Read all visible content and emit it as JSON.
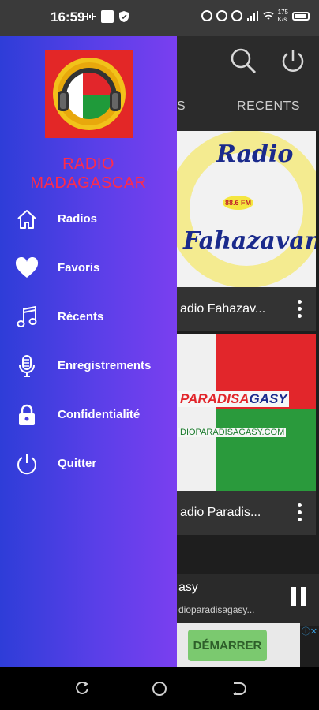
{
  "status_bar": {
    "time": "16:59",
    "net_speed_top": "175",
    "net_speed_bottom": "K/s"
  },
  "drawer": {
    "app_title_line1": "RADIO",
    "app_title_line2": "MADAGASCAR",
    "items": [
      {
        "label": "Radios",
        "icon": "home-icon"
      },
      {
        "label": "Favoris",
        "icon": "heart-icon"
      },
      {
        "label": "Récents",
        "icon": "music-note-icon"
      },
      {
        "label": "Enregistrements",
        "icon": "microphone-icon"
      },
      {
        "label": "Confidentialité",
        "icon": "lock-icon"
      },
      {
        "label": "Quitter",
        "icon": "power-icon"
      }
    ]
  },
  "background": {
    "tab_partial": "S",
    "tab_recents": "RECENTS",
    "stations": [
      {
        "name": "adio Fahazav...",
        "logo_text_top": "Radio",
        "logo_text_bottom": "Fahazavana",
        "logo_freq": "88.6 FM"
      },
      {
        "name": "adio Paradis...",
        "logo_text_top": "PARADISA",
        "logo_text_top2": "GASY",
        "logo_url": "DIOPARADISAGASY.COM"
      }
    ],
    "player": {
      "title": "asy",
      "subtitle": "dioparadisagasy..."
    },
    "ad": {
      "button": "DÉMARRER"
    }
  },
  "colors": {
    "drawer_start": "#2e3dd8",
    "drawer_end": "#7a3ff0",
    "title": "#ff2b4a"
  }
}
